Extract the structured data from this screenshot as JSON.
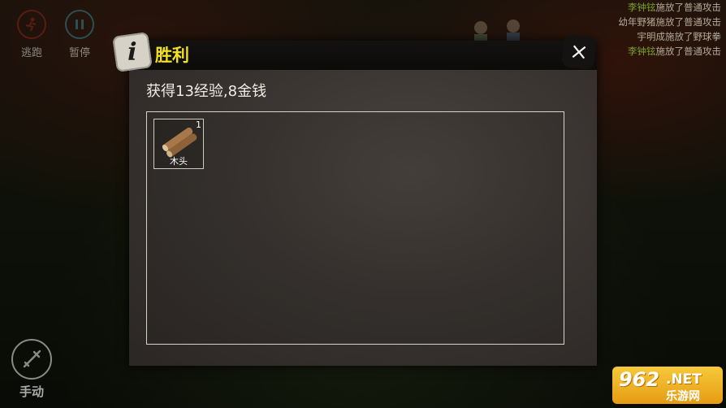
{
  "hud": {
    "flee_label": "逃跑",
    "pause_label": "暂停",
    "manual_label": "手动"
  },
  "battle_log": [
    {
      "actor": "李钟铉",
      "action": "施放了普通攻击"
    },
    {
      "actor": "",
      "action": "幼年野猪施放了普通攻击"
    },
    {
      "actor": "",
      "action": "宇明成施放了野球拳"
    },
    {
      "actor": "李钟铉",
      "action": "施放了普通攻击"
    }
  ],
  "dialog": {
    "title": "胜利",
    "info_icon": "i",
    "reward_text": "获得13经验,8金钱",
    "items": [
      {
        "name": "木头",
        "quantity": "1",
        "icon": "wood-log-icon"
      }
    ]
  },
  "watermark": {
    "number": "962",
    "domain": ".NET",
    "subtitle": "乐游网"
  },
  "colors": {
    "title": "#f2e21c",
    "log_actor": "#7aa32a",
    "log_text": "#b4ac98"
  }
}
